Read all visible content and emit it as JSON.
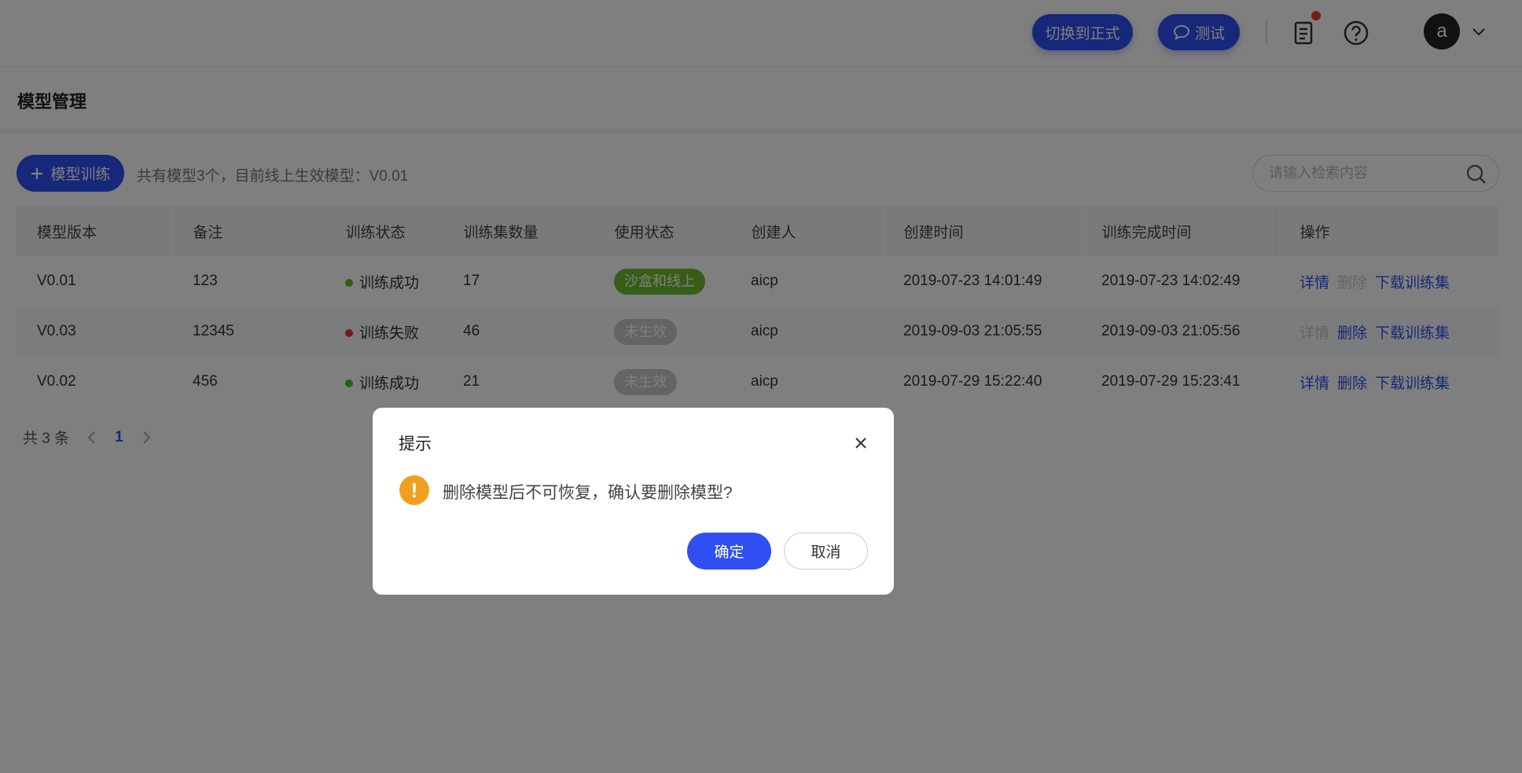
{
  "header": {
    "switch_button": "切换到正式",
    "test_button": "测试",
    "avatar_letter": "a",
    "icons": [
      "docs-icon",
      "help-icon",
      "chevron-down-icon"
    ]
  },
  "page": {
    "title": "模型管理",
    "add_button": "模型训练",
    "summary": "共有模型3个，目前线上生效模型：V0.01",
    "search_placeholder": "请输入检索内容"
  },
  "table": {
    "headers": [
      "模型版本",
      "备注",
      "训练状态",
      "训练集数量",
      "使用状态",
      "创建人",
      "创建时间",
      "训练完成时间",
      "操作"
    ],
    "rows": [
      {
        "version": "V0.01",
        "note": "123",
        "train_status": "训练成功",
        "status_color": "#52c41a",
        "count": "17",
        "use_status": "沙盒和线上",
        "use_color": "#6dbd2e",
        "creator": "aicp",
        "created": "2019-07-23 14:01:49",
        "finished": "2019-07-23 14:02:49",
        "ops": [
          "详情",
          "删除",
          "下载训练集"
        ],
        "ops_enabled": [
          true,
          false,
          true
        ]
      },
      {
        "version": "V0.03",
        "note": "12345",
        "train_status": "训练失败",
        "status_color": "#e53935",
        "count": "46",
        "use_status": "未生效",
        "use_color": "#c8c8c8",
        "creator": "aicp",
        "created": "2019-09-03 21:05:55",
        "finished": "2019-09-03 21:05:56",
        "ops": [
          "详情",
          "删除",
          "下载训练集"
        ],
        "ops_enabled": [
          false,
          true,
          true
        ]
      },
      {
        "version": "V0.02",
        "note": "456",
        "train_status": "训练成功",
        "status_color": "#52c41a",
        "count": "21",
        "use_status": "未生效",
        "use_color": "#c8c8c8",
        "creator": "aicp",
        "created": "2019-07-29 15:22:40",
        "finished": "2019-07-29 15:23:41",
        "ops": [
          "详情",
          "删除",
          "下载训练集"
        ],
        "ops_enabled": [
          true,
          true,
          true
        ]
      }
    ]
  },
  "pagination": {
    "total": "共 3 条",
    "current": "1"
  },
  "modal": {
    "title": "提示",
    "message": "删除模型后不可恢复，确认要删除模型?",
    "ok": "确定",
    "cancel": "取消",
    "warning_glyph": "!"
  },
  "colors": {
    "primary": "#2f4ff2",
    "success": "#52c41a",
    "error": "#e53935",
    "warning": "#f0a020"
  }
}
